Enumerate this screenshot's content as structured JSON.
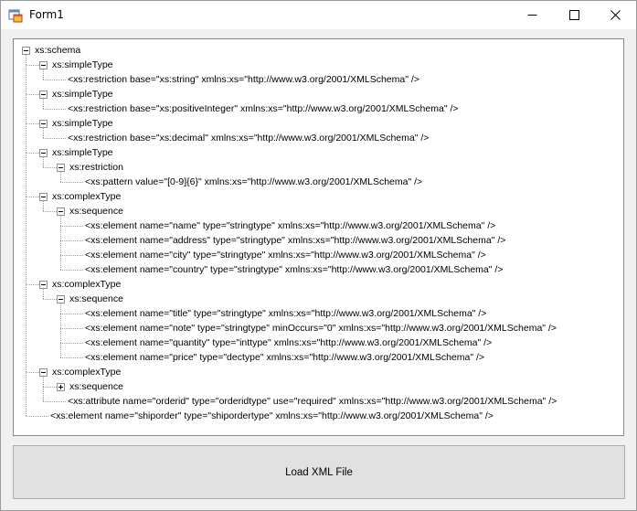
{
  "window": {
    "title": "Form1"
  },
  "tree": {
    "nodes": [
      {
        "label": "xs:schema"
      },
      {
        "label": "xs:simpleType"
      },
      {
        "label": "<xs:restriction base=\"xs:string\" xmlns:xs=\"http://www.w3.org/2001/XMLSchema\" />"
      },
      {
        "label": "xs:simpleType"
      },
      {
        "label": "<xs:restriction base=\"xs:positiveInteger\" xmlns:xs=\"http://www.w3.org/2001/XMLSchema\" />"
      },
      {
        "label": "xs:simpleType"
      },
      {
        "label": "<xs:restriction base=\"xs:decimal\" xmlns:xs=\"http://www.w3.org/2001/XMLSchema\" />"
      },
      {
        "label": "xs:simpleType"
      },
      {
        "label": "xs:restriction"
      },
      {
        "label": "<xs:pattern value=\"[0-9]{6}\" xmlns:xs=\"http://www.w3.org/2001/XMLSchema\" />"
      },
      {
        "label": "xs:complexType"
      },
      {
        "label": "xs:sequence"
      },
      {
        "label": "<xs:element name=\"name\" type=\"stringtype\" xmlns:xs=\"http://www.w3.org/2001/XMLSchema\" />"
      },
      {
        "label": "<xs:element name=\"address\" type=\"stringtype\" xmlns:xs=\"http://www.w3.org/2001/XMLSchema\" />"
      },
      {
        "label": "<xs:element name=\"city\" type=\"stringtype\" xmlns:xs=\"http://www.w3.org/2001/XMLSchema\" />"
      },
      {
        "label": "<xs:element name=\"country\" type=\"stringtype\" xmlns:xs=\"http://www.w3.org/2001/XMLSchema\" />"
      },
      {
        "label": "xs:complexType"
      },
      {
        "label": "xs:sequence"
      },
      {
        "label": "<xs:element name=\"title\" type=\"stringtype\" xmlns:xs=\"http://www.w3.org/2001/XMLSchema\" />"
      },
      {
        "label": "<xs:element name=\"note\" type=\"stringtype\" minOccurs=\"0\" xmlns:xs=\"http://www.w3.org/2001/XMLSchema\" />"
      },
      {
        "label": "<xs:element name=\"quantity\" type=\"inttype\" xmlns:xs=\"http://www.w3.org/2001/XMLSchema\" />"
      },
      {
        "label": "<xs:element name=\"price\" type=\"dectype\" xmlns:xs=\"http://www.w3.org/2001/XMLSchema\" />"
      },
      {
        "label": "xs:complexType"
      },
      {
        "label": "xs:sequence"
      },
      {
        "label": "<xs:attribute name=\"orderid\" type=\"orderidtype\" use=\"required\" xmlns:xs=\"http://www.w3.org/2001/XMLSchema\" />"
      },
      {
        "label": "<xs:element name=\"shiporder\" type=\"shipordertype\" xmlns:xs=\"http://www.w3.org/2001/XMLSchema\" />"
      }
    ]
  },
  "load_button": {
    "label": "Load XML File"
  }
}
